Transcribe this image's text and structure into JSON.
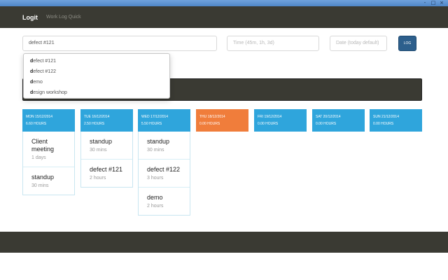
{
  "window": {
    "controls": [
      "-",
      "□",
      "×"
    ]
  },
  "navbar": {
    "brand": "Logit",
    "link": "Work Log Quick"
  },
  "form": {
    "task_value": "defect #121",
    "time_placeholder": "Time (45m, 1h, 3d)",
    "date_placeholder": "Date (today default)",
    "log_label": "LOG"
  },
  "suggestions": [
    {
      "first": "d",
      "rest": "efect #121"
    },
    {
      "first": "d",
      "rest": "efect #122"
    },
    {
      "first": "d",
      "rest": "emo"
    },
    {
      "first": "d",
      "rest": "esign workshop"
    }
  ],
  "days": [
    {
      "name": "MON 15/12/2014",
      "hours": "6.60 HOURS",
      "today": false,
      "entries": [
        {
          "title": "Client meeting",
          "duration": "1 days"
        },
        {
          "title": "standup",
          "duration": "30 mins"
        }
      ]
    },
    {
      "name": "TUE 16/12/2014",
      "hours": "2.50 HOURS",
      "today": false,
      "entries": [
        {
          "title": "standup",
          "duration": "30 mins"
        },
        {
          "title": "defect #121",
          "duration": "2 hours"
        }
      ]
    },
    {
      "name": "WED 17/12/2014",
      "hours": "5.50 HOURS",
      "today": false,
      "entries": [
        {
          "title": "standup",
          "duration": "30 mins"
        },
        {
          "title": "defect #122",
          "duration": "3 hours"
        },
        {
          "title": "demo",
          "duration": "2 hours"
        }
      ]
    },
    {
      "name": "THU 18/12/2014",
      "hours": "0.00 HOURS",
      "today": true,
      "entries": []
    },
    {
      "name": "FRI 19/12/2014",
      "hours": "0.00 HOURS",
      "today": false,
      "entries": []
    },
    {
      "name": "SAT 20/12/2014",
      "hours": "0.00 HOURS",
      "today": false,
      "entries": []
    },
    {
      "name": "SUN 21/12/2014",
      "hours": "0.00 HOURS",
      "today": false,
      "entries": []
    }
  ],
  "colors": {
    "navbar": "#3a3a33",
    "day_header": "#2fa5dc",
    "today_header": "#f07d3b",
    "log_button": "#2d5f8c"
  }
}
